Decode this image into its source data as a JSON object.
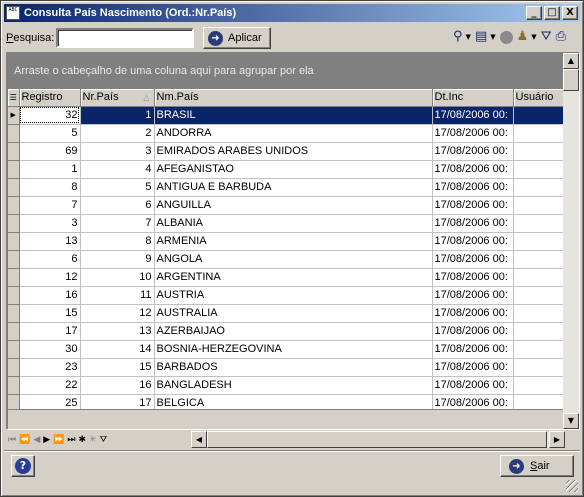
{
  "window": {
    "title": "Consulta País Nascimento (Ord.:Nr.País)",
    "app_icon_text": "ABC",
    "minimize": "_",
    "maximize": "□",
    "close": "X"
  },
  "toolbar": {
    "search_label_u": "P",
    "search_label_rest": "esquisa:",
    "search_value": "",
    "apply_label": "Aplicar",
    "icons": [
      "tree-icon",
      "dropdown-arrow",
      "columns-icon",
      "dropdown-arrow",
      "disk-icon",
      "person-icon",
      "dropdown-arrow",
      "filter-icon",
      "print-icon"
    ]
  },
  "grid": {
    "group_hint": "Arraste o cabeçalho de uma coluna aqui para agrupar por ela",
    "columns": [
      "Registro",
      "Nr.País",
      "Nm.País",
      "Dt.Inc",
      "Usuário"
    ],
    "rows": [
      {
        "registro": "32",
        "nr": "1",
        "nm": "BRASIL",
        "dt": "17/08/2006 00:",
        "us": "",
        "selected": true
      },
      {
        "registro": "5",
        "nr": "2",
        "nm": "ANDORRA",
        "dt": "17/08/2006 00:",
        "us": ""
      },
      {
        "registro": "69",
        "nr": "3",
        "nm": "EMIRADOS ARABES UNIDOS",
        "dt": "17/08/2006 00:",
        "us": ""
      },
      {
        "registro": "1",
        "nr": "4",
        "nm": "AFEGANISTAO",
        "dt": "17/08/2006 00:",
        "us": ""
      },
      {
        "registro": "8",
        "nr": "5",
        "nm": "ANTIGUA E BARBUDA",
        "dt": "17/08/2006 00:",
        "us": ""
      },
      {
        "registro": "7",
        "nr": "6",
        "nm": "ANGUILLA",
        "dt": "17/08/2006 00:",
        "us": ""
      },
      {
        "registro": "3",
        "nr": "7",
        "nm": "ALBANIA",
        "dt": "17/08/2006 00:",
        "us": ""
      },
      {
        "registro": "13",
        "nr": "8",
        "nm": "ARMENIA",
        "dt": "17/08/2006 00:",
        "us": ""
      },
      {
        "registro": "6",
        "nr": "9",
        "nm": "ANGOLA",
        "dt": "17/08/2006 00:",
        "us": ""
      },
      {
        "registro": "12",
        "nr": "10",
        "nm": "ARGENTINA",
        "dt": "17/08/2006 00:",
        "us": ""
      },
      {
        "registro": "16",
        "nr": "11",
        "nm": "AUSTRIA",
        "dt": "17/08/2006 00:",
        "us": ""
      },
      {
        "registro": "15",
        "nr": "12",
        "nm": "AUSTRALIA",
        "dt": "17/08/2006 00:",
        "us": ""
      },
      {
        "registro": "17",
        "nr": "13",
        "nm": "AZERBAIJAO",
        "dt": "17/08/2006 00:",
        "us": ""
      },
      {
        "registro": "30",
        "nr": "14",
        "nm": "BOSNIA-HERZEGOVINA",
        "dt": "17/08/2006 00:",
        "us": ""
      },
      {
        "registro": "23",
        "nr": "15",
        "nm": "BARBADOS",
        "dt": "17/08/2006 00:",
        "us": ""
      },
      {
        "registro": "22",
        "nr": "16",
        "nm": "BANGLADESH",
        "dt": "17/08/2006 00:",
        "us": ""
      },
      {
        "registro": "25",
        "nr": "17",
        "nm": "BELGICA",
        "dt": "17/08/2006 00:",
        "us": ""
      }
    ]
  },
  "navigator": {
    "buttons": [
      "first-icon",
      "prev-page-icon",
      "prev-icon",
      "next-icon",
      "next-page-icon",
      "last-icon",
      "insert-icon",
      "delete-icon",
      "filter-icon"
    ]
  },
  "footer": {
    "help_label": "?",
    "exit_label_u": "S",
    "exit_label_rest": "air"
  },
  "colors": {
    "selection": "#0a246a",
    "face": "#d4d0c8",
    "group_panel": "#808080"
  }
}
